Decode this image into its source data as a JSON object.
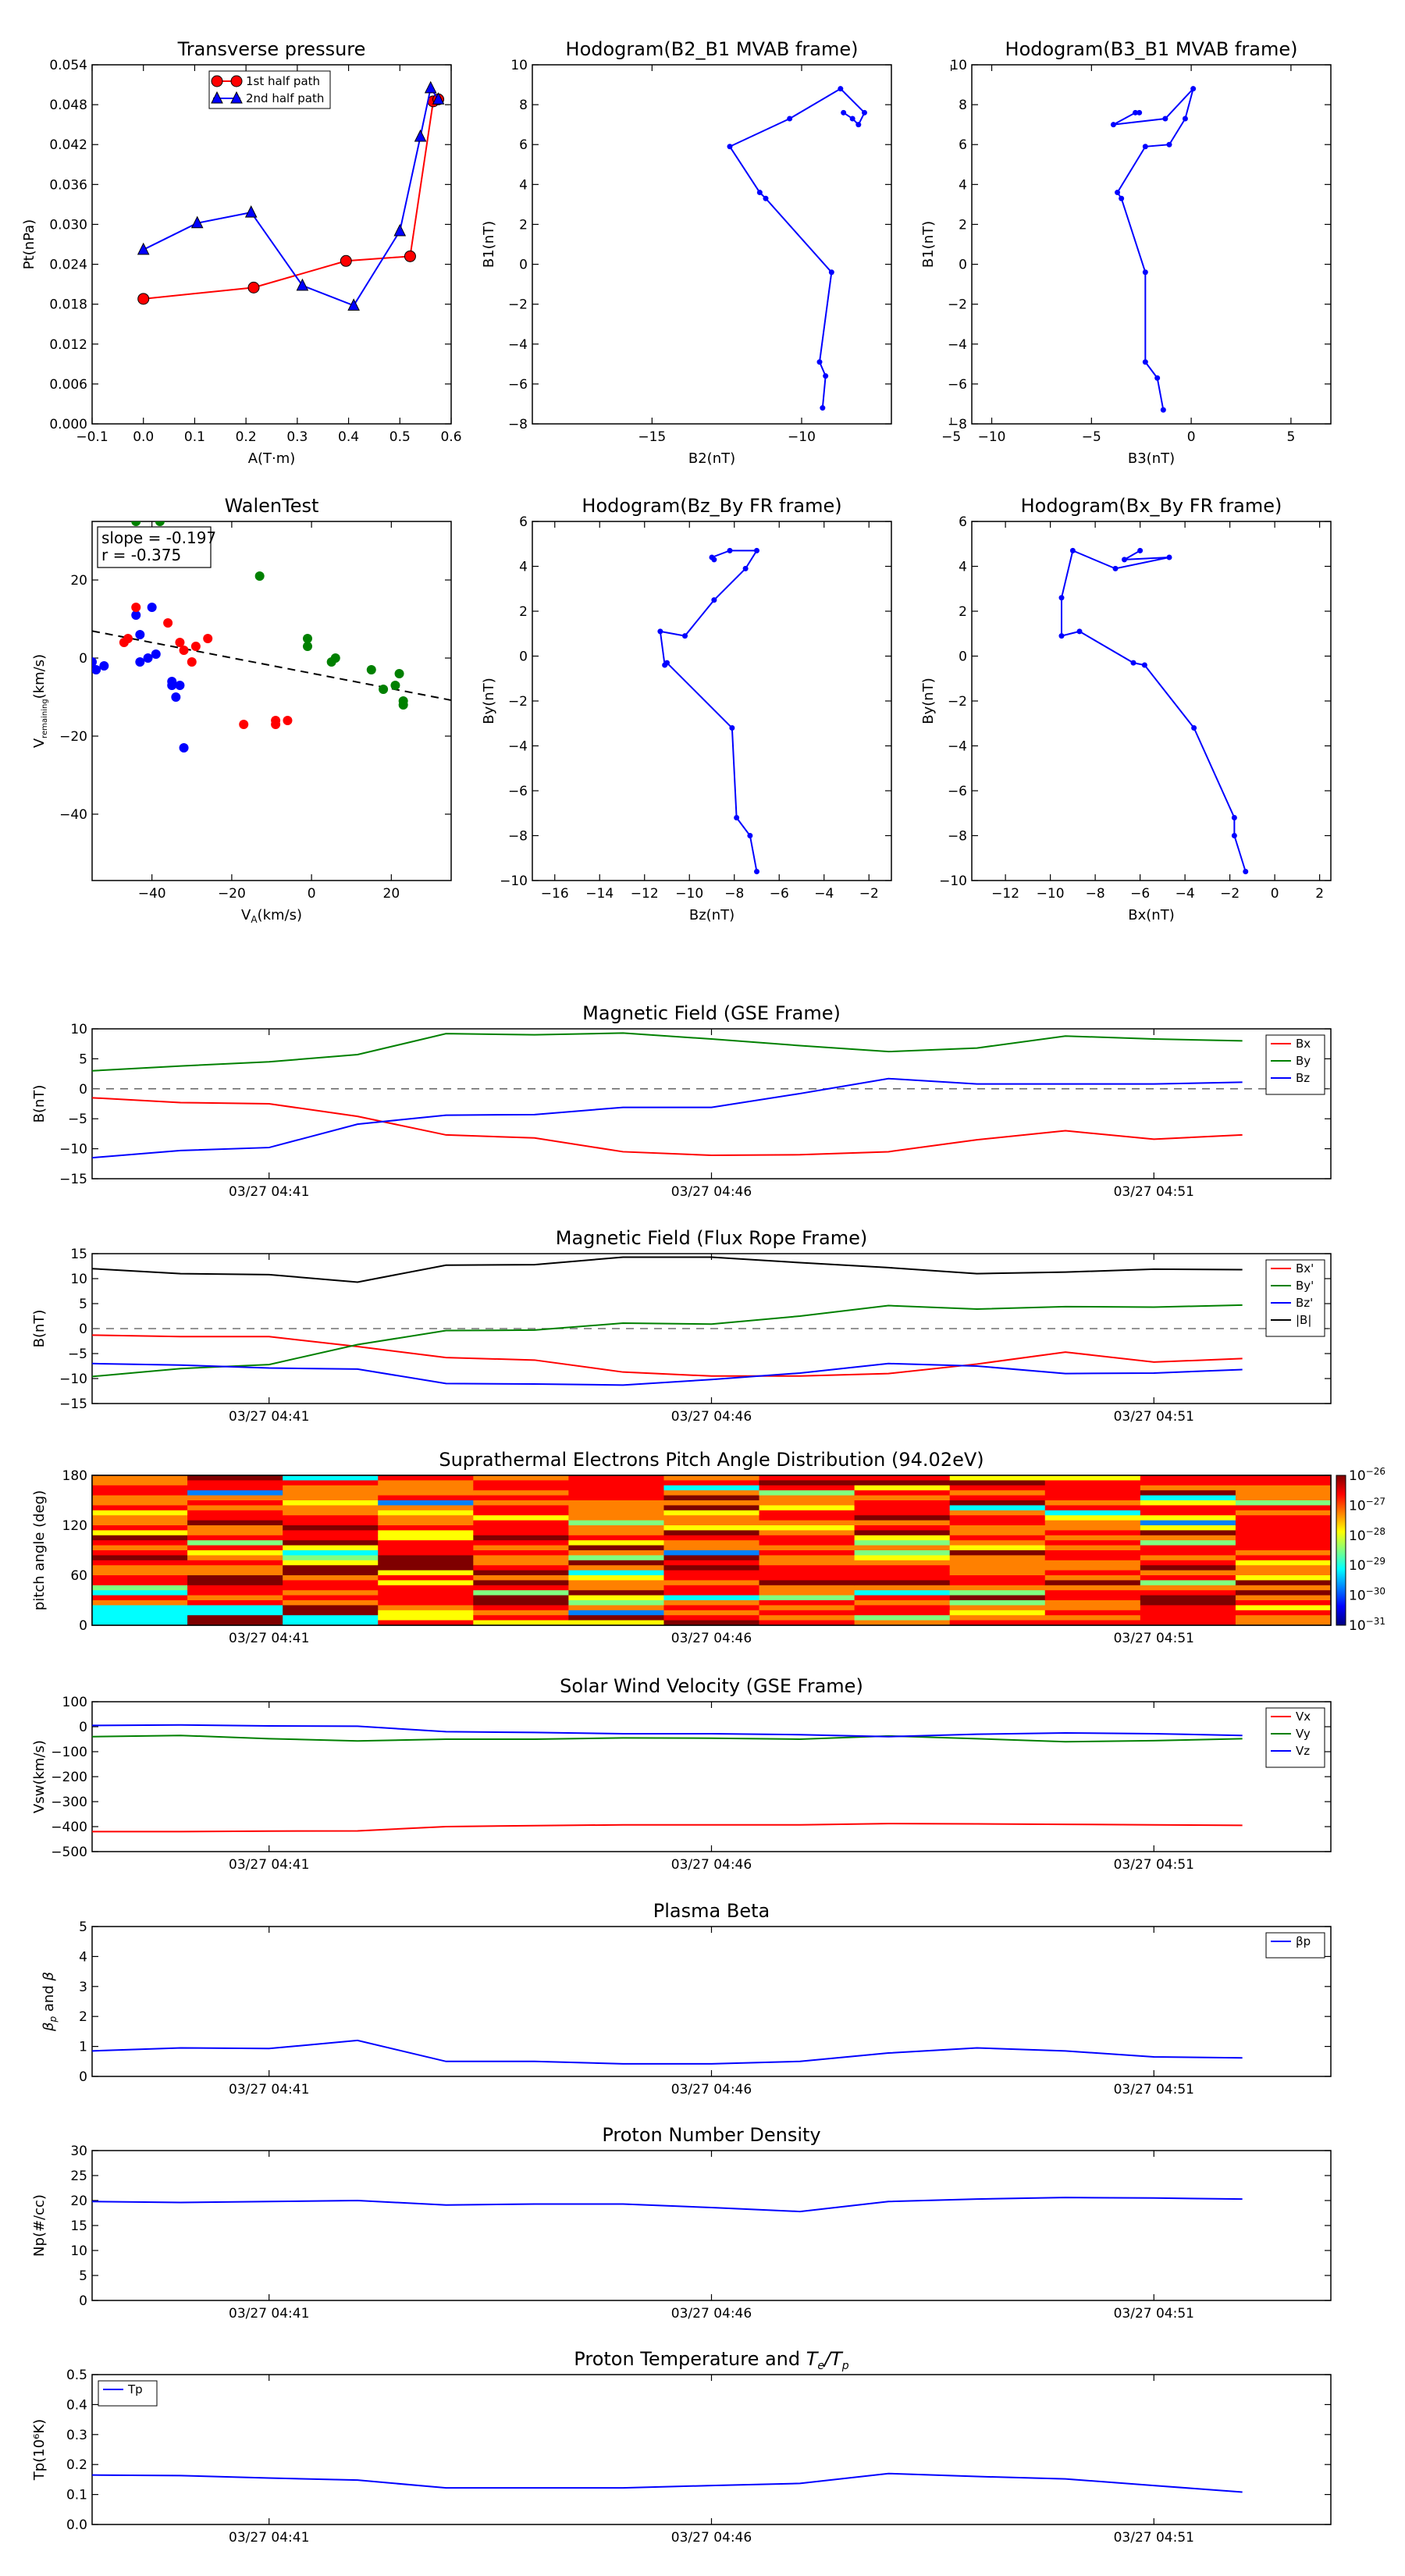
{
  "top_charts": [
    {
      "id": "transverse-pressure",
      "type": "line",
      "title": "Transverse pressure",
      "xlabel": "A(T·m)",
      "ylabel": "Pt(nPa)",
      "xlim": [
        -0.1,
        0.6
      ],
      "ylim": [
        0.0,
        0.054
      ],
      "xticks": [
        -0.1,
        0.0,
        0.1,
        0.2,
        0.3,
        0.4,
        0.5,
        0.6
      ],
      "xtick_labels": [
        "−0.1",
        "0.0",
        "0.1",
        "0.2",
        "0.3",
        "0.4",
        "0.5",
        "0.6"
      ],
      "yticks": [
        0.0,
        0.006,
        0.012,
        0.018,
        0.024,
        0.03,
        0.036,
        0.042,
        0.048,
        0.054
      ],
      "ytick_labels": [
        "0.000",
        "0.006",
        "0.012",
        "0.018",
        "0.024",
        "0.030",
        "0.036",
        "0.042",
        "0.048",
        "0.054"
      ],
      "legend": {
        "position": "top-center",
        "entries": [
          "1st half path",
          "2nd half path"
        ]
      },
      "series": [
        {
          "name": "1st half path",
          "color": "#ff0000",
          "marker": "circle",
          "x": [
            0.0,
            0.215,
            0.395,
            0.52,
            0.565,
            0.575
          ],
          "y": [
            0.0188,
            0.0205,
            0.0245,
            0.0252,
            0.0485,
            0.0488
          ]
        },
        {
          "name": "2nd half path",
          "color": "#0000ff",
          "marker": "triangle",
          "x": [
            0.575,
            0.56,
            0.54,
            0.5,
            0.41,
            0.31,
            0.21,
            0.105,
            0.0
          ],
          "y": [
            0.0488,
            0.0505,
            0.0432,
            0.029,
            0.0178,
            0.0208,
            0.0318,
            0.0302,
            0.0262
          ]
        }
      ]
    },
    {
      "id": "hodogram-b2-b1",
      "type": "line",
      "title": "Hodogram(B2_B1 MVAB frame)",
      "xlabel": "B2(nT)",
      "ylabel": "B1(nT)",
      "xlim": [
        -19,
        -7
      ],
      "ylim": [
        -8,
        10
      ],
      "xticks": [
        -15,
        -10,
        -5
      ],
      "xtick_labels": [
        "−15",
        "−10",
        "−5"
      ],
      "yticks": [
        -8,
        -6,
        -4,
        -2,
        0,
        2,
        4,
        6,
        8,
        10
      ],
      "ytick_labels": [
        "−8",
        "−6",
        "−4",
        "−2",
        "0",
        "2",
        "4",
        "6",
        "8",
        "10"
      ],
      "series": [
        {
          "name": "",
          "color": "#0000ff",
          "marker": "dot",
          "x": [
            -9.3,
            -9.2,
            -9.4,
            -9.0,
            -11.2,
            -11.4,
            -12.4,
            -10.4,
            -8.7,
            -7.9,
            -8.1,
            -8.3,
            -8.6
          ],
          "y": [
            -7.2,
            -5.6,
            -4.9,
            -0.4,
            3.3,
            3.6,
            5.9,
            7.3,
            8.8,
            7.6,
            7.0,
            7.3,
            7.6
          ]
        }
      ]
    },
    {
      "id": "hodogram-b3-b1",
      "type": "line",
      "title": "Hodogram(B3_B1 MVAB frame)",
      "xlabel": "B3(nT)",
      "ylabel": "B1(nT)",
      "xlim": [
        -11,
        7
      ],
      "ylim": [
        -8,
        10
      ],
      "xticks": [
        -10,
        -5,
        0,
        5
      ],
      "xtick_labels": [
        "−10",
        "−5",
        "0",
        "5"
      ],
      "yticks": [
        -8,
        -6,
        -4,
        -2,
        0,
        2,
        4,
        6,
        8,
        10
      ],
      "ytick_labels": [
        "−8",
        "−6",
        "−4",
        "−2",
        "0",
        "2",
        "4",
        "6",
        "8",
        "10"
      ],
      "series": [
        {
          "name": "",
          "color": "#0000ff",
          "marker": "dot",
          "x": [
            -1.4,
            -1.7,
            -2.3,
            -2.3,
            -3.5,
            -3.7,
            -2.3,
            -1.1,
            -0.3,
            0.1,
            -1.3,
            -3.9,
            -2.8,
            -2.6
          ],
          "y": [
            -7.3,
            -5.7,
            -4.9,
            -0.4,
            3.3,
            3.6,
            5.9,
            6.0,
            7.3,
            8.8,
            7.3,
            7.0,
            7.6,
            7.6
          ]
        }
      ]
    },
    {
      "id": "walen-test",
      "type": "scatter",
      "title": "WalenTest",
      "xlabel": "VA(km/s)",
      "ylabel": "Vremaining(km/s)",
      "xlim": [
        -55,
        35
      ],
      "ylim": [
        -57,
        35
      ],
      "xticks": [
        -40,
        -20,
        0,
        20
      ],
      "xtick_labels": [
        "−40",
        "−20",
        "0",
        "20"
      ],
      "yticks": [
        -40,
        -20,
        0,
        20
      ],
      "ytick_labels": [
        "−40",
        "−20",
        "0",
        "20"
      ],
      "annotation_lines": [
        "slope = -0.197",
        "r = -0.375"
      ],
      "fit_line": {
        "slope": -0.197,
        "intercept": -3.9,
        "style": "dashed"
      },
      "series": [
        {
          "name": "",
          "color": "#0000ff",
          "x": [
            -55,
            -54,
            -52,
            -43,
            -40,
            -39,
            -41,
            -43,
            -44,
            -33,
            -35,
            -34,
            -35,
            -32
          ],
          "y": [
            -1,
            -3,
            -2,
            6,
            13,
            1,
            0,
            -1,
            11,
            -7,
            -6,
            -10,
            -7,
            -23
          ]
        },
        {
          "name": "",
          "color": "#ff0000",
          "x": [
            -44,
            -46,
            -47,
            -36,
            -33,
            -32,
            -30,
            -29,
            -26,
            -17,
            -9,
            -9,
            -6
          ],
          "y": [
            13,
            5,
            4,
            9,
            4,
            2,
            -1,
            3,
            5,
            -17,
            -16,
            -17,
            -16
          ]
        },
        {
          "name": "",
          "color": "#008000",
          "x": [
            -44,
            -38,
            -13,
            -1,
            -1,
            5,
            6,
            15,
            18,
            21,
            22,
            23,
            23
          ],
          "y": [
            35,
            35,
            21,
            5,
            3,
            -1,
            0,
            -3,
            -8,
            -7,
            -4,
            -11,
            -12
          ]
        }
      ]
    },
    {
      "id": "hodogram-bz-by",
      "type": "line",
      "title": "Hodogram(Bz_By FR frame)",
      "xlabel": "Bz(nT)",
      "ylabel": "By(nT)",
      "xlim": [
        -17,
        -1
      ],
      "ylim": [
        -10,
        6
      ],
      "xticks": [
        -16,
        -14,
        -12,
        -10,
        -8,
        -6,
        -4,
        -2
      ],
      "xtick_labels": [
        "−16",
        "−14",
        "−12",
        "−10",
        "−8",
        "−6",
        "−4",
        "−2"
      ],
      "yticks": [
        -10,
        -8,
        -6,
        -4,
        -2,
        0,
        2,
        4,
        6
      ],
      "ytick_labels": [
        "−10",
        "−8",
        "−6",
        "−4",
        "−2",
        "0",
        "2",
        "4",
        "6"
      ],
      "series": [
        {
          "name": "",
          "color": "#0000ff",
          "marker": "dot",
          "x": [
            -7.0,
            -7.3,
            -7.9,
            -8.1,
            -11.0,
            -11.1,
            -11.3,
            -10.2,
            -8.9,
            -7.5,
            -7.0,
            -8.2,
            -9.0,
            -8.9
          ],
          "y": [
            -9.6,
            -8.0,
            -7.2,
            -3.2,
            -0.3,
            -0.4,
            1.1,
            0.9,
            2.5,
            3.9,
            4.7,
            4.7,
            4.4,
            4.3
          ]
        }
      ]
    },
    {
      "id": "hodogram-bx-by",
      "type": "line",
      "title": "Hodogram(Bx_By FR frame)",
      "xlabel": "Bx(nT)",
      "ylabel": "By(nT)",
      "xlim": [
        -13.5,
        2.5
      ],
      "ylim": [
        -10,
        6
      ],
      "xticks": [
        -12,
        -10,
        -8,
        -6,
        -4,
        -2,
        0,
        2
      ],
      "xtick_labels": [
        "−12",
        "−10",
        "−8",
        "−6",
        "−4",
        "−2",
        "0",
        "2"
      ],
      "yticks": [
        -10,
        -8,
        -6,
        -4,
        -2,
        0,
        2,
        4,
        6
      ],
      "ytick_labels": [
        "−10",
        "−8",
        "−6",
        "−4",
        "−2",
        "0",
        "2",
        "4",
        "6"
      ],
      "series": [
        {
          "name": "",
          "color": "#0000ff",
          "marker": "dot",
          "x": [
            -1.3,
            -1.8,
            -1.8,
            -3.6,
            -5.8,
            -6.3,
            -8.7,
            -9.5,
            -9.5,
            -9.0,
            -7.1,
            -4.7,
            -6.7,
            -6.0
          ],
          "y": [
            -9.6,
            -8.0,
            -7.2,
            -3.2,
            -0.4,
            -0.3,
            1.1,
            0.9,
            2.6,
            4.7,
            3.9,
            4.4,
            4.3,
            4.7
          ]
        }
      ]
    }
  ],
  "time_axis": {
    "x": [
      "04:39",
      "04:40",
      "04:41",
      "04:42",
      "04:43",
      "04:44",
      "04:45",
      "04:46",
      "04:47",
      "04:48",
      "04:49",
      "04:50",
      "04:51",
      "04:52",
      "04:53"
    ],
    "ticks": [
      "04:41",
      "04:46",
      "04:51"
    ],
    "tick_labels": [
      "03/27 04:41",
      "03/27 04:46",
      "03/27 04:51"
    ]
  },
  "time_panels": [
    {
      "id": "magnetic-field-gse",
      "type": "line",
      "title": "Magnetic Field (GSE Frame)",
      "ylabel": "B(nT)",
      "ylim": [
        -15,
        10
      ],
      "yticks": [
        -15,
        -10,
        -5,
        0,
        5,
        10
      ],
      "ytick_labels": [
        "−15",
        "−10",
        "−5",
        "0",
        "5",
        "10"
      ],
      "zero_line": true,
      "legend": {
        "position": "top-right",
        "entries": [
          "Bx",
          "By",
          "Bz"
        ]
      },
      "series": [
        {
          "name": "Bx",
          "color": "#ff0000",
          "values": [
            -1.5,
            -2.3,
            -2.5,
            -4.6,
            -7.7,
            -8.2,
            -10.5,
            -11.1,
            -11.0,
            -10.5,
            -8.5,
            -7.0,
            -8.4,
            -7.7
          ]
        },
        {
          "name": "By",
          "color": "#008000",
          "values": [
            3.0,
            3.8,
            4.5,
            5.7,
            9.2,
            9.0,
            9.3,
            8.3,
            7.2,
            6.2,
            6.8,
            8.8,
            8.3,
            8.0
          ]
        },
        {
          "name": "Bz",
          "color": "#0000ff",
          "values": [
            -11.5,
            -10.3,
            -9.8,
            -5.9,
            -4.4,
            -4.3,
            -3.1,
            -3.1,
            -0.8,
            1.7,
            0.8,
            0.8,
            0.8,
            1.1
          ]
        }
      ]
    },
    {
      "id": "magnetic-field-flux-rope",
      "type": "line",
      "title": "Magnetic Field (Flux Rope Frame)",
      "ylabel": "B(nT)",
      "ylim": [
        -15,
        15
      ],
      "yticks": [
        -15,
        -10,
        -5,
        0,
        5,
        10,
        15
      ],
      "ytick_labels": [
        "−15",
        "−10",
        "−5",
        "0",
        "5",
        "10",
        "15"
      ],
      "zero_line": true,
      "legend": {
        "position": "top-right",
        "entries": [
          "Bx'",
          "By'",
          "Bz'",
          "|B|"
        ]
      },
      "series": [
        {
          "name": "Bx'",
          "color": "#ff0000",
          "values": [
            -1.3,
            -1.6,
            -1.6,
            -3.6,
            -5.8,
            -6.3,
            -8.7,
            -9.5,
            -9.5,
            -9.0,
            -7.1,
            -4.7,
            -6.7,
            -6.0
          ]
        },
        {
          "name": "By'",
          "color": "#008000",
          "values": [
            -9.6,
            -8.0,
            -7.2,
            -3.2,
            -0.4,
            -0.3,
            1.1,
            0.9,
            2.5,
            4.6,
            3.9,
            4.4,
            4.3,
            4.7
          ]
        },
        {
          "name": "Bz'",
          "color": "#0000ff",
          "values": [
            -7.0,
            -7.3,
            -7.9,
            -8.1,
            -11.0,
            -11.1,
            -11.3,
            -10.2,
            -8.9,
            -7.0,
            -7.5,
            -9.0,
            -8.9,
            -8.2
          ]
        },
        {
          "name": "|B|",
          "color": "#000000",
          "values": [
            12.0,
            11.0,
            10.8,
            9.3,
            12.7,
            12.8,
            14.3,
            14.3,
            13.2,
            12.2,
            11.0,
            11.3,
            11.9,
            11.8
          ]
        }
      ]
    },
    {
      "id": "pitch-angle-distribution",
      "type": "heatmap",
      "title": "Suprathermal Electrons Pitch Angle Distribution (94.02eV)",
      "ylabel": "pitch angle (deg)",
      "ylim": [
        0,
        180
      ],
      "yticks": [
        0,
        60,
        120,
        180
      ],
      "ytick_labels": [
        "0",
        "60",
        "120",
        "180"
      ],
      "colorbar": {
        "scale": "log",
        "range_exponents": [
          -31,
          -26
        ],
        "tick_exponents": [
          -26,
          -27,
          -28,
          -29,
          -30,
          -31
        ],
        "colors": [
          "#00007f",
          "#0000ff",
          "#0080ff",
          "#00ffff",
          "#80ff80",
          "#ffff00",
          "#ff8000",
          "#ff0000",
          "#7f0000"
        ]
      }
    },
    {
      "id": "solar-wind-velocity",
      "type": "line",
      "title": "Solar Wind Velocity (GSE Frame)",
      "ylabel": "Vsw(km/s)",
      "ylim": [
        -500,
        100
      ],
      "yticks": [
        -500,
        -400,
        -300,
        -200,
        -100,
        0,
        100
      ],
      "ytick_labels": [
        "−500",
        "−400",
        "−300",
        "−200",
        "−100",
        "0",
        "100"
      ],
      "legend": {
        "position": "top-right",
        "entries": [
          "Vx",
          "Vy",
          "Vz"
        ]
      },
      "series": [
        {
          "name": "Vx",
          "color": "#ff0000",
          "values": [
            -420,
            -420,
            -418,
            -417,
            -400,
            -396,
            -393,
            -393,
            -393,
            -388,
            -389,
            -391,
            -393,
            -395
          ]
        },
        {
          "name": "Vy",
          "color": "#008000",
          "values": [
            -40,
            -35,
            -48,
            -57,
            -50,
            -50,
            -45,
            -46,
            -50,
            -37,
            -48,
            -60,
            -56,
            -48
          ]
        },
        {
          "name": "Vz",
          "color": "#0000ff",
          "values": [
            5,
            7,
            3,
            2,
            -20,
            -23,
            -28,
            -28,
            -32,
            -40,
            -30,
            -25,
            -28,
            -35
          ]
        }
      ]
    },
    {
      "id": "plasma-beta",
      "type": "line",
      "title": "Plasma Beta",
      "ylabel": "βp and β",
      "ylim": [
        0,
        5
      ],
      "yticks": [
        0,
        1,
        2,
        3,
        4,
        5
      ],
      "ytick_labels": [
        "0",
        "1",
        "2",
        "3",
        "4",
        "5"
      ],
      "legend": {
        "position": "top-right",
        "entries": [
          "βp"
        ]
      },
      "series": [
        {
          "name": "βp",
          "color": "#0000ff",
          "values": [
            0.85,
            0.95,
            0.93,
            1.2,
            0.5,
            0.5,
            0.42,
            0.42,
            0.5,
            0.78,
            0.95,
            0.85,
            0.65,
            0.62
          ]
        }
      ]
    },
    {
      "id": "proton-number-density",
      "type": "line",
      "title": "Proton Number Density",
      "ylabel": "Np(#/cc)",
      "ylim": [
        0,
        30
      ],
      "yticks": [
        0,
        5,
        10,
        15,
        20,
        25,
        30
      ],
      "ytick_labels": [
        "0",
        "5",
        "10",
        "15",
        "20",
        "25",
        "30"
      ],
      "series": [
        {
          "name": "",
          "color": "#0000ff",
          "values": [
            19.8,
            19.6,
            19.8,
            20.0,
            19.1,
            19.3,
            19.3,
            18.6,
            17.8,
            19.8,
            20.3,
            20.6,
            20.5,
            20.3
          ]
        }
      ]
    },
    {
      "id": "proton-temperature",
      "type": "line",
      "title": "Proton Temperature and Te/Tp",
      "ylabel": "Tp(10⁶K)",
      "ylim": [
        0,
        0.5
      ],
      "yticks": [
        0,
        0.1,
        0.2,
        0.3,
        0.4,
        0.5
      ],
      "ytick_labels": [
        "0.0",
        "0.1",
        "0.2",
        "0.3",
        "0.4",
        "0.5"
      ],
      "legend": {
        "position": "top-left",
        "entries": [
          "Tp"
        ]
      },
      "series": [
        {
          "name": "Tp",
          "color": "#0000ff",
          "values": [
            0.165,
            0.163,
            0.155,
            0.148,
            0.122,
            0.122,
            0.122,
            0.13,
            0.137,
            0.17,
            0.16,
            0.152,
            0.13,
            0.108
          ]
        }
      ]
    }
  ]
}
